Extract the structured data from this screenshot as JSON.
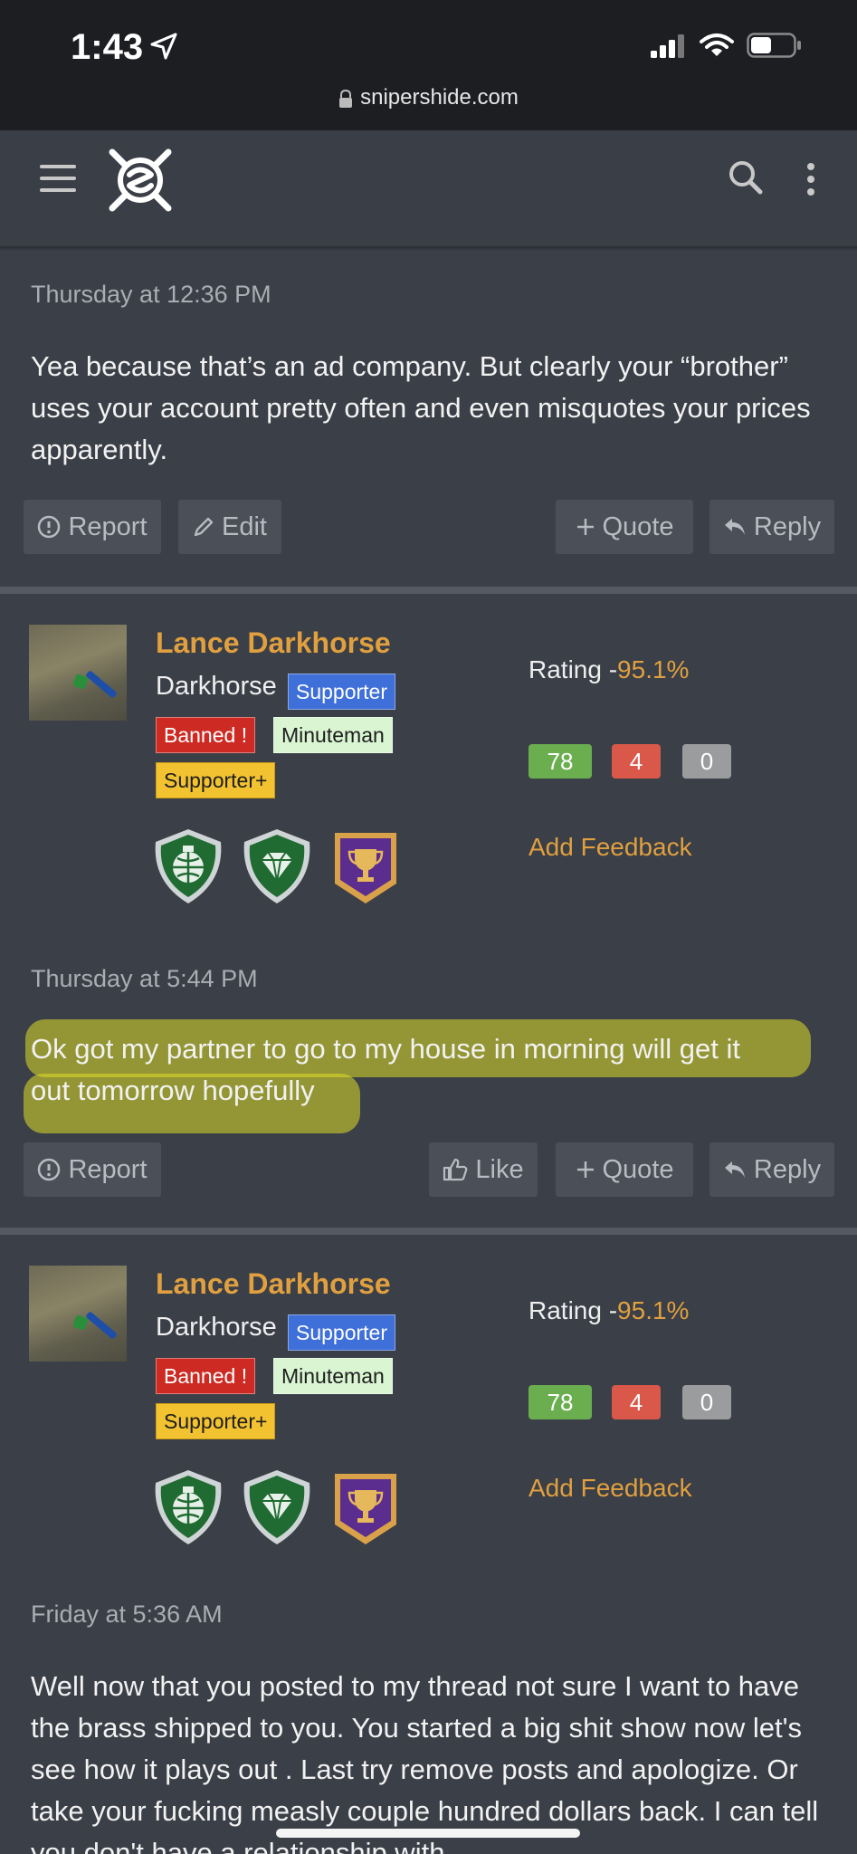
{
  "status_bar": {
    "time": "1:43",
    "url": "snipershide.com"
  },
  "nav": {
    "menu_icon": "hamburger-icon",
    "logo_icon": "sniperhide-logo-icon",
    "search_icon": "search-icon",
    "more_icon": "kebab-icon"
  },
  "post1": {
    "timestamp": "Thursday at 12:36 PM",
    "message": "Yea because that’s an ad company. But clearly your “brother” uses your account pretty often and even misquotes your prices apparently.",
    "report": "Report",
    "edit": "Edit",
    "quote": "Quote",
    "reply": "Reply"
  },
  "user": {
    "name": "Lance Darkhorse",
    "title": "Darkhorse",
    "badges": {
      "supporter": "Supporter",
      "banned": "Banned !",
      "minuteman": "Minuteman",
      "supporter_plus": "Supporter+"
    },
    "rating_label": "Rating -",
    "rating_value": "95.1%",
    "feedback": {
      "positive": "78",
      "negative": "4",
      "neutral": "0"
    },
    "add_feedback": "Add Feedback",
    "awards": [
      "grenade-globe-award-icon",
      "diamond-award-icon",
      "trophy-award-icon"
    ]
  },
  "post2": {
    "timestamp": "Thursday at 5:44 PM",
    "message_line1": "Ok got my partner to go to my house in morning will get it",
    "message_line2": "out tomorrow hopefully",
    "report": "Report",
    "like": "Like",
    "quote": "Quote",
    "reply": "Reply"
  },
  "post3": {
    "timestamp": "Friday at 5:36 AM",
    "message": "Well now that you posted to my thread not sure I want to have the brass shipped to you. You started a big shit show now let's see how it plays out . Last try remove posts and apologize. Or take your fucking measly couple hundred dollars back. I can tell you don't have a relationship with"
  },
  "colors": {
    "accent": "#e0a040",
    "background": "#3b3f47",
    "positive": "#6aae50",
    "negative": "#d9584a",
    "neutral": "#9a9c9e"
  }
}
